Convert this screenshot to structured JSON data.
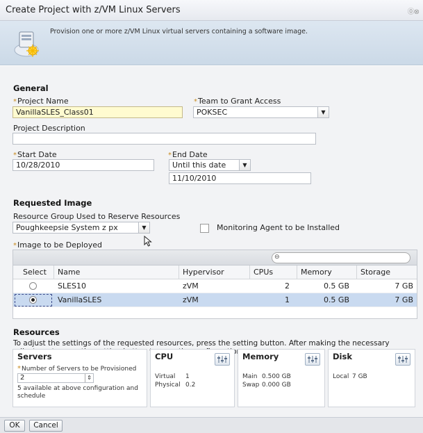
{
  "window": {
    "title": "Create Project with z/VM Linux Servers",
    "controls": "⓪⊗"
  },
  "banner": {
    "description": "Provision one or more z/VM Linux virtual servers containing a software image."
  },
  "general": {
    "title": "General",
    "required_mark": "*",
    "project_name_label": "Project Name",
    "project_name_value": "VanillaSLES_Class01",
    "team_label": "Team to Grant Access",
    "team_value": "POKSEC",
    "description_label": "Project Description",
    "description_value": "",
    "start_date_label": "Start Date",
    "start_date_value": "10/28/2010",
    "end_date_label": "End Date",
    "end_date_mode": "Until this date",
    "end_date_value": "11/10/2010"
  },
  "image": {
    "title": "Requested Image",
    "resource_group_label": "Resource Group Used to Reserve Resources",
    "resource_group_value": "Poughkeepsie System z px",
    "monitoring_label": "Monitoring Agent to be Installed",
    "monitoring_checked": false,
    "image_label": "Image to be Deployed",
    "columns": [
      "Select",
      "Name",
      "Hypervisor",
      "CPUs",
      "Memory",
      "Storage"
    ],
    "rows": [
      {
        "name": "SLES10",
        "hypervisor": "zVM",
        "cpus": "2",
        "memory": "0.5 GB",
        "storage": "7 GB",
        "selected": false
      },
      {
        "name": "VanillaSLES",
        "hypervisor": "zVM",
        "cpus": "1",
        "memory": "0.5 GB",
        "storage": "7 GB",
        "selected": true
      }
    ]
  },
  "resources": {
    "title": "Resources",
    "instructions": "To adjust the settings of the requested resources, press the setting button. After making the necessary adjustment, press the setting button to save the configuration.",
    "servers": {
      "title": "Servers",
      "count_label": "Number of Servers to be Provisioned",
      "count_value": "2",
      "availability": "5 available at above configuration and schedule"
    },
    "cpu": {
      "title": "CPU",
      "virtual_label": "Virtual",
      "virtual_value": "1",
      "physical_label": "Physical",
      "physical_value": "0.2"
    },
    "memory": {
      "title": "Memory",
      "main_label": "Main",
      "main_value": "0.500 GB",
      "swap_label": "Swap",
      "swap_value": "0.000 GB"
    },
    "disk": {
      "title": "Disk",
      "local_label": "Local",
      "local_value": "7 GB"
    }
  },
  "footer": {
    "ok_label": "OK",
    "cancel_label": "Cancel"
  },
  "colors": {
    "accent": "#c88a1e",
    "selection": "#c9daf0",
    "banner": "#d4e0ec"
  },
  "icons": [
    "server-wizard-icon",
    "dropdown-arrow-icon",
    "filter-icon",
    "stepper-icon",
    "settings-icon",
    "mouse-pointer-icon"
  ]
}
